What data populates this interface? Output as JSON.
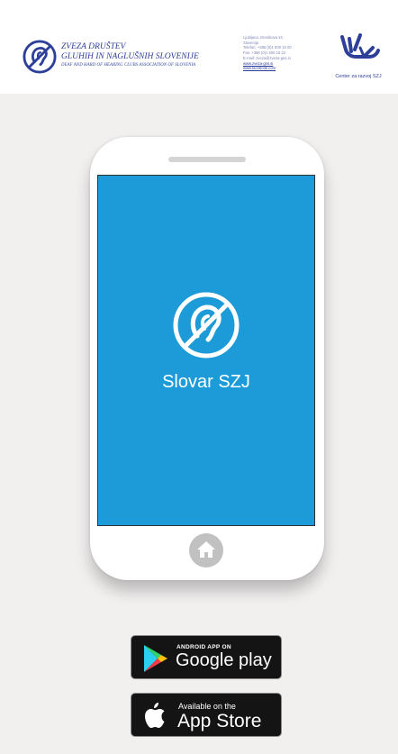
{
  "header": {
    "org_line1": "ZVEZA DRUŠTEV",
    "org_line2": "GLUHIH IN NAGLUŠNIH SLOVENIJE",
    "org_line3": "DEAF AND HARD OF HEARING CLUBS ASSOCIATION OF SLOVENIA",
    "contact": [
      "Ljubljana, Drenikova 24,",
      "Slovenija",
      "Telefon: +386 (0)1 500 15 00",
      "Fax: +386 (0)1 500 15 22",
      "E-mail: zveza@zveza-gns.si"
    ],
    "links": [
      "www.zveza-gns.si",
      "www.facebook.com"
    ],
    "center_label": "Center za razvoj SZJ"
  },
  "app": {
    "title": "Slovar SZJ"
  },
  "badges": {
    "google_small": "ANDROID APP ON",
    "google_big": "Google play",
    "apple_small": "Available on the",
    "apple_big": "App Store"
  },
  "colors": {
    "background": "#f2efef",
    "screen": "#1c9bd8",
    "org_blue": "#2e3f99",
    "badge": "#141414"
  }
}
